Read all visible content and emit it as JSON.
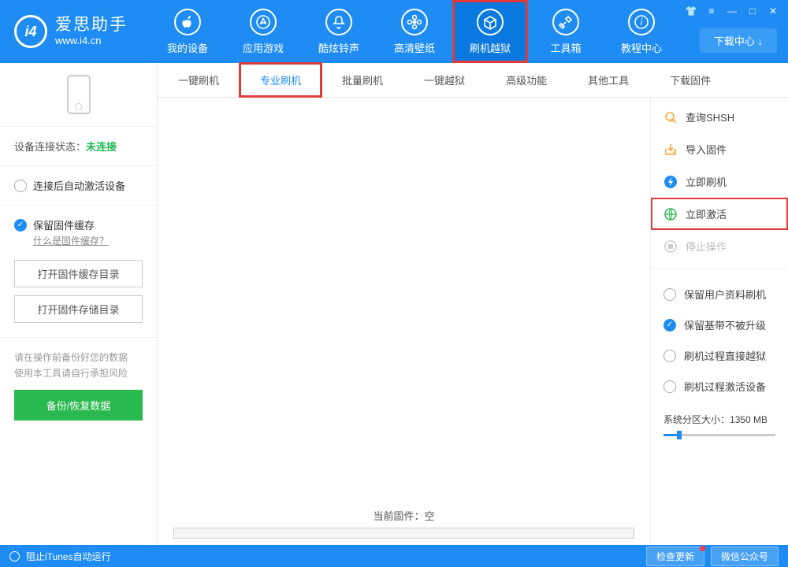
{
  "app": {
    "title": "爱思助手",
    "subdomain": "www.i4.cn"
  },
  "window_buttons": {
    "shirt": "👕",
    "skin": "≡",
    "min": "—",
    "max": "□",
    "close": "✕"
  },
  "dl_center": "下载中心 ↓",
  "nav": [
    {
      "label": "我的设备",
      "icon": "apple"
    },
    {
      "label": "应用游戏",
      "icon": "appstore"
    },
    {
      "label": "酷炫铃声",
      "icon": "bell"
    },
    {
      "label": "高清壁纸",
      "icon": "flower"
    },
    {
      "label": "刷机越狱",
      "icon": "box",
      "active": true,
      "highlight": true
    },
    {
      "label": "工具箱",
      "icon": "tools"
    },
    {
      "label": "教程中心",
      "icon": "info"
    }
  ],
  "subnav": [
    {
      "label": "一键刷机"
    },
    {
      "label": "专业刷机",
      "active": true,
      "highlight": true
    },
    {
      "label": "批量刷机"
    },
    {
      "label": "一键越狱"
    },
    {
      "label": "高级功能"
    },
    {
      "label": "其他工具"
    },
    {
      "label": "下载固件"
    }
  ],
  "sidebar": {
    "status_label": "设备连接状态：",
    "status_value": "未连接",
    "auto_activate": "连接后自动激活设备",
    "keep_cache": "保留固件缓存",
    "cache_help": "什么是固件缓存？",
    "open_cache_dir": "打开固件缓存目录",
    "open_store_dir": "打开固件存储目录",
    "note_l1": "请在操作前备份好您的数据",
    "note_l2": "使用本工具请自行承担风险",
    "backup_btn": "备份/恢复数据"
  },
  "content": {
    "current_fw_label": "当前固件：",
    "current_fw_value": "空"
  },
  "right": {
    "actions": [
      {
        "label": "查询SHSH",
        "icon": "search",
        "color": "#f2a93b"
      },
      {
        "label": "导入固件",
        "icon": "import",
        "color": "#f2a93b"
      },
      {
        "label": "立即刷机",
        "icon": "flash",
        "color": "#1e8cf2"
      },
      {
        "label": "立即激活",
        "icon": "globe",
        "color": "#2ab94f",
        "highlight": true
      },
      {
        "label": "停止操作",
        "icon": "stop",
        "disabled": true
      }
    ],
    "options": [
      {
        "label": "保留用户资料刷机",
        "checked": false
      },
      {
        "label": "保留基带不被升级",
        "checked": true
      },
      {
        "label": "刷机过程直接越狱",
        "checked": false
      },
      {
        "label": "刷机过程激活设备",
        "checked": false
      }
    ],
    "sys_partition_label": "系统分区大小：",
    "sys_partition_value": "1350 MB"
  },
  "footer": {
    "itunes_block": "阻止iTunes自动运行",
    "check_update": "检查更新",
    "wechat": "微信公众号"
  }
}
